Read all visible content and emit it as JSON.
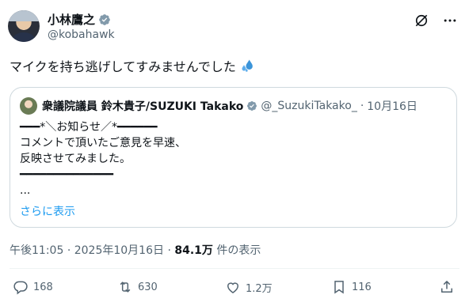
{
  "author": {
    "display_name": "小林鷹之",
    "handle": "@kobahawk"
  },
  "tweet": {
    "text": "マイクを持ち逃げしてすみませんでした"
  },
  "quote": {
    "display_name": "衆議院議員 鈴木貴子/SUZUKI Takako",
    "handle": "@_SuzukiTakako_",
    "separator": "·",
    "date": "10月16日",
    "lines": [
      "━━━*＼お知らせ／*━━━━━━",
      "コメントで頂いたご意見を早速、",
      "反映させてみました。",
      "━━━━━━━━━━━━━━",
      "",
      "..."
    ],
    "show_more": "さらに表示"
  },
  "meta": {
    "time": "午後11:05",
    "sep1": "·",
    "date": "2025年10月16日",
    "sep2": "·",
    "views": "84.1万",
    "views_label": "件の表示"
  },
  "actions": {
    "replies": "168",
    "reposts": "630",
    "likes": "1.2万",
    "bookmarks": "116"
  },
  "colors": {
    "verified": "#829aab",
    "link": "#1d9bf0",
    "secondary_text": "#536471",
    "border": "#cfd9de"
  },
  "icons": [
    "verified-badge-icon",
    "grok-slash-icon",
    "more-icon",
    "sweat-drops-emoji",
    "reply-icon",
    "repost-icon",
    "like-icon",
    "bookmark-icon",
    "share-icon"
  ]
}
